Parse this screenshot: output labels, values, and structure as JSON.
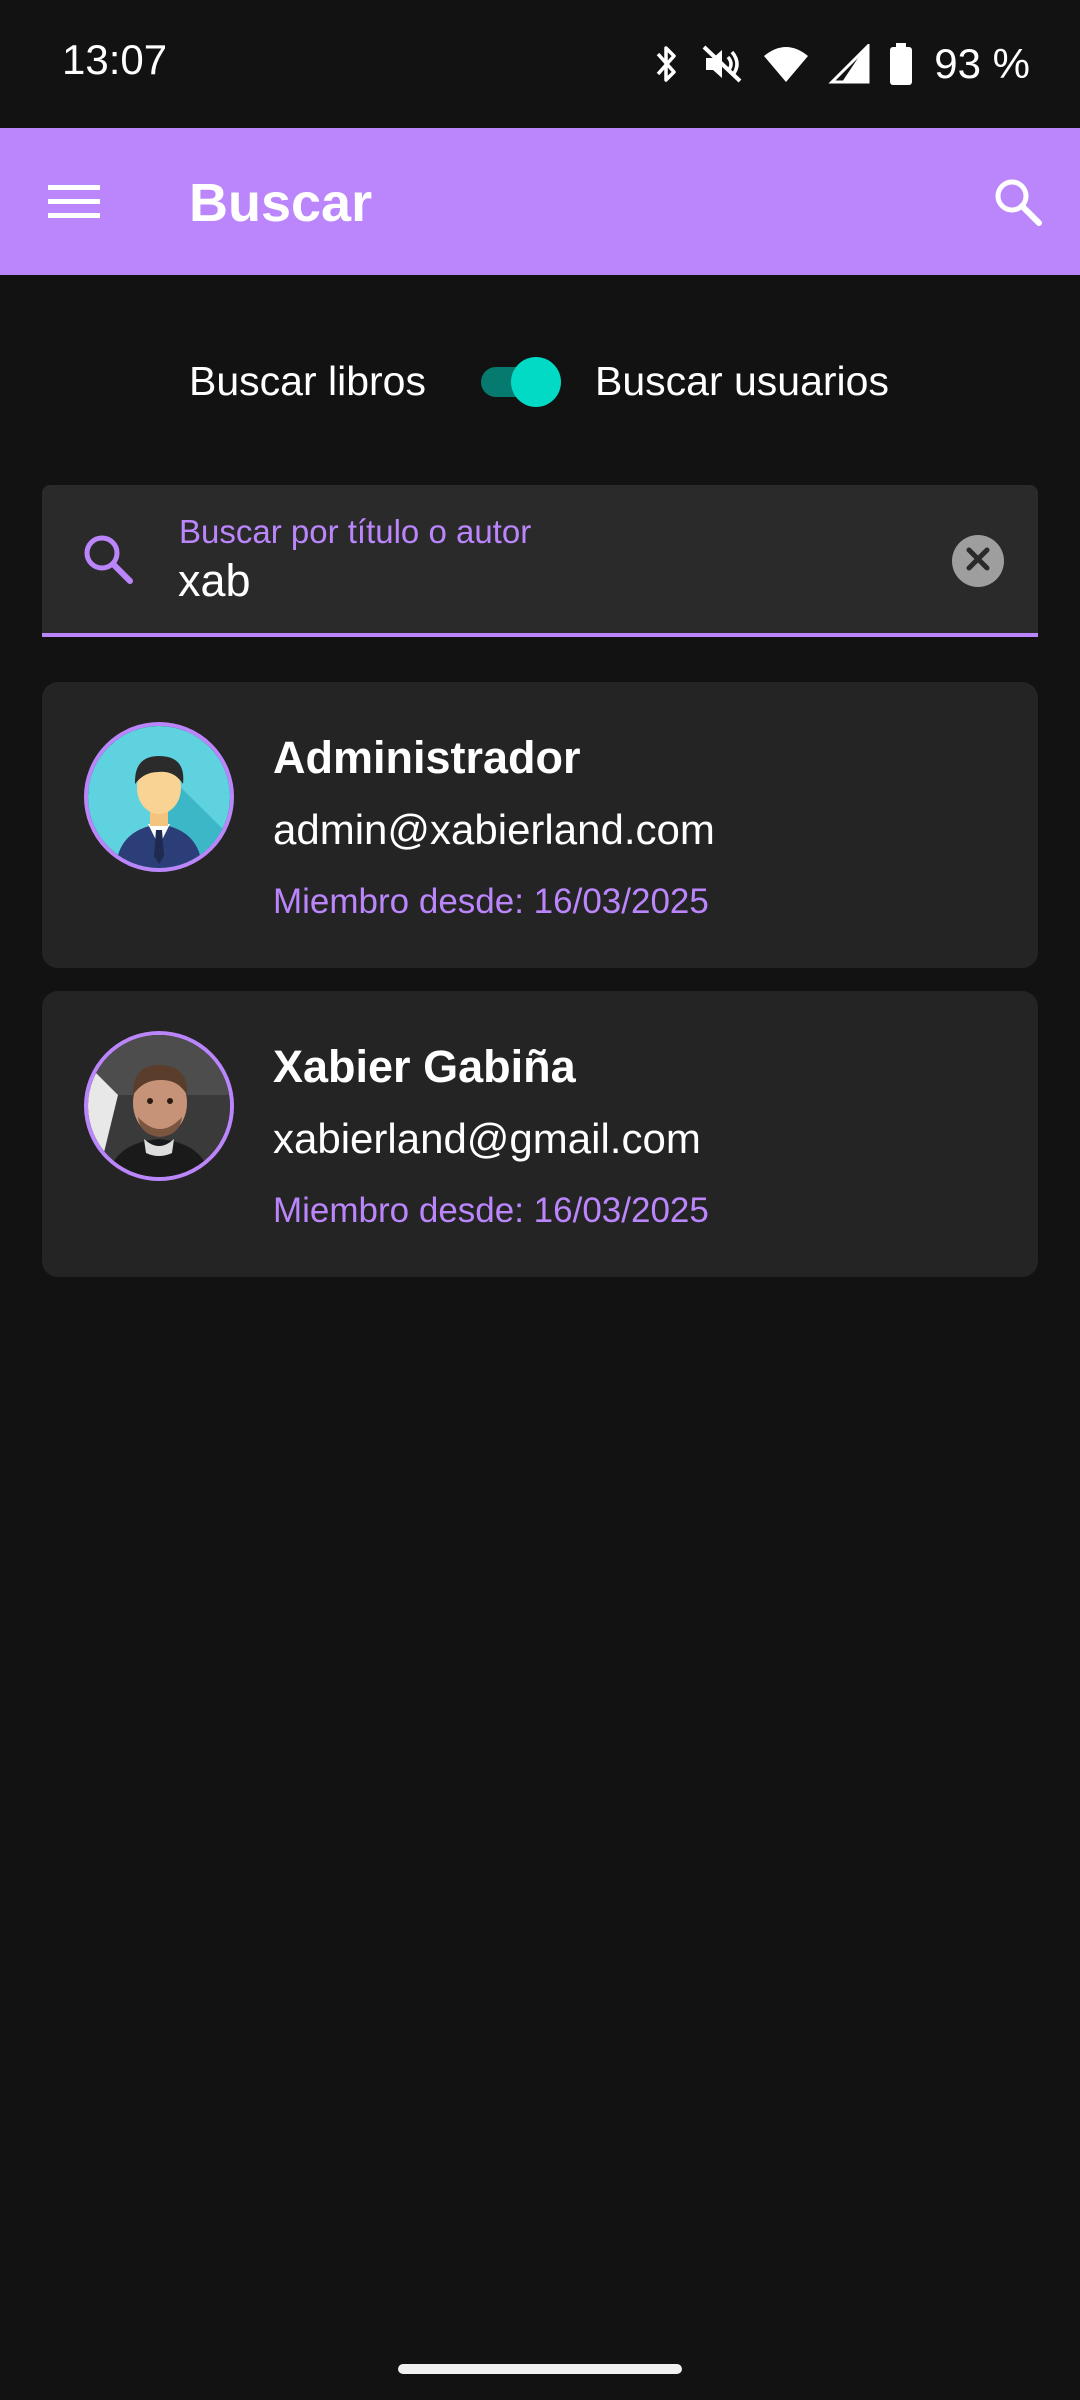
{
  "status_bar": {
    "time": "13:07",
    "battery": "93 %",
    "icons": [
      "bluetooth-icon",
      "mute-icon",
      "wifi-icon",
      "signal-icon",
      "battery-icon"
    ]
  },
  "app_bar": {
    "title": "Buscar",
    "background": "#bb86fc",
    "menu_icon": "menu-icon",
    "action_icon": "search-icon"
  },
  "toggle": {
    "left_label": "Buscar libros",
    "right_label": "Buscar usuarios",
    "checked": true,
    "accent": "#03dac5"
  },
  "search": {
    "label": "Buscar por título o autor",
    "value": "xab",
    "lead_icon": "search-icon",
    "trail_icon": "clear-icon"
  },
  "results": [
    {
      "name": "Administrador",
      "email": "admin@xabierland.com",
      "since": "Miembro desde: 16/03/2025",
      "avatar": "admin-avatar-illustration"
    },
    {
      "name": "Xabier Gabiña",
      "email": "xabierland@gmail.com",
      "since": "Miembro desde: 16/03/2025",
      "avatar": "user-photo"
    }
  ],
  "colors": {
    "background": "#121212",
    "card": "#242424",
    "accent": "#bb86fc"
  }
}
